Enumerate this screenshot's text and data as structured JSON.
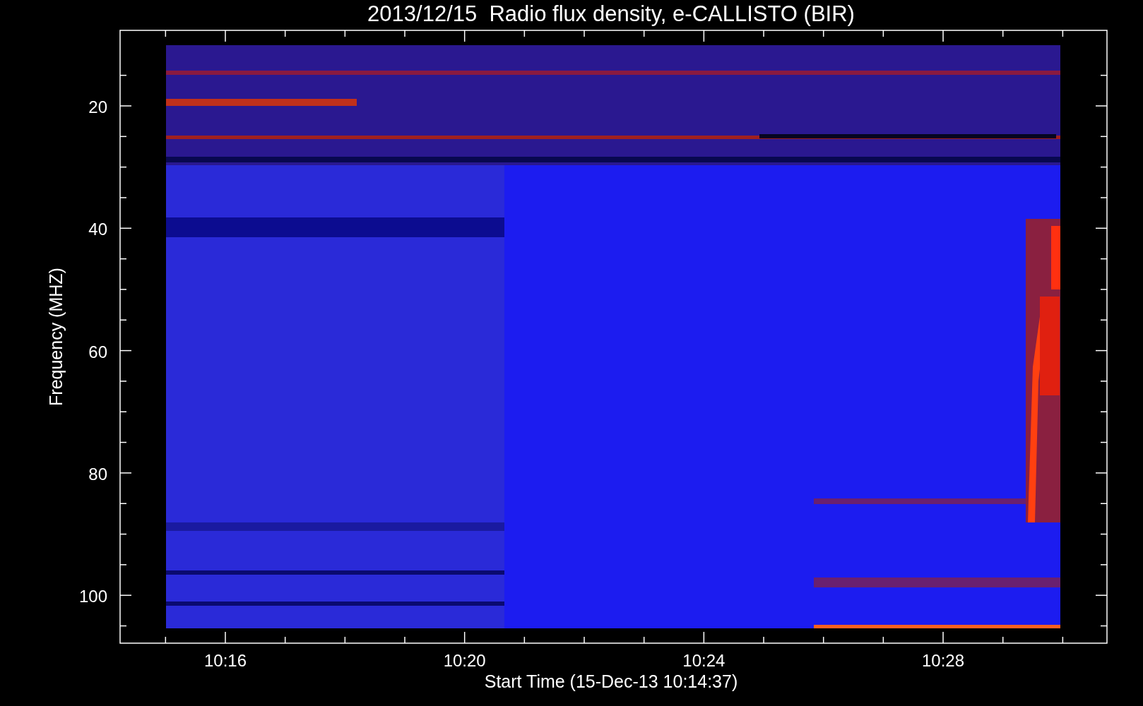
{
  "plot": {
    "title": "2013/12/15  Radio flux density, e-CALLISTO (BIR)",
    "ylabel": "Frequency (MHZ)",
    "xlabel": "Start Time (15-Dec-13 10:14:37)",
    "yticks": [
      "20",
      "40",
      "60",
      "80",
      "100"
    ],
    "xticks": [
      "10:16",
      "10:20",
      "10:24",
      "10:28"
    ]
  }
}
